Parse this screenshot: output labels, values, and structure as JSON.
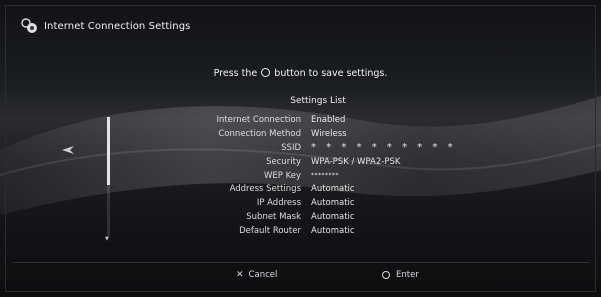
{
  "window": {
    "title": "Internet Connection Settings"
  },
  "prompt": {
    "before": "Press the",
    "after": "button to save settings."
  },
  "list": {
    "title": "Settings List",
    "rows": [
      {
        "label": "Internet Connection",
        "value": "Enabled"
      },
      {
        "label": "Connection Method",
        "value": "Wireless"
      },
      {
        "label": "SSID",
        "value": "* * * * * * * * * *"
      },
      {
        "label": "Security",
        "value": "WPA-PSK / WPA2-PSK"
      },
      {
        "label": "WEP Key",
        "value": "********"
      },
      {
        "label": "Address Settings",
        "value": "Automatic"
      },
      {
        "label": "IP Address",
        "value": "Automatic"
      },
      {
        "label": "Subnet Mask",
        "value": "Automatic"
      },
      {
        "label": "Default Router",
        "value": "Automatic"
      }
    ]
  },
  "footer": {
    "cancel_glyph": "✕",
    "cancel_label": "Cancel",
    "enter_label": "Enter"
  },
  "icons": {
    "title": "network-settings-icon",
    "back": "back-arrow-icon",
    "cancel": "cross-icon",
    "enter": "circle-icon",
    "scroll_more": "scroll-down-arrow-icon"
  }
}
